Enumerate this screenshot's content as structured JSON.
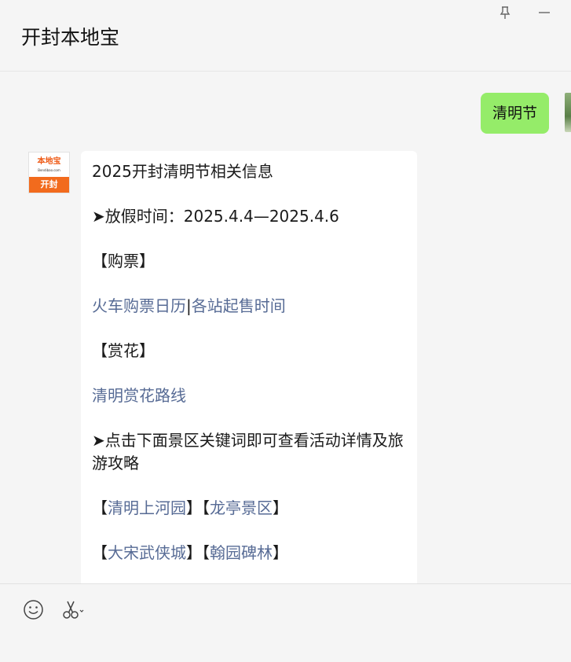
{
  "window": {
    "title": "开封本地宝",
    "pin_icon": "pin-icon",
    "minimize_icon": "minimize-icon"
  },
  "messages": {
    "outgoing": {
      "text": "清明节"
    },
    "incoming": {
      "avatar": {
        "brand": "本地宝",
        "url": "Bendibao.com",
        "city": "开封"
      },
      "heading": "2025开封清明节相关信息",
      "holiday": "➤放假时间：2025.4.4—2025.4.6",
      "ticket_section": "【购票】",
      "ticket_link_1": "火车购票日历",
      "ticket_separator": "|",
      "ticket_link_2": "各站起售时间",
      "flower_section": "【赏花】",
      "flower_link": "清明赏花路线",
      "scenic_intro": "➤点击下面景区关键词即可查看活动详情及旅游攻略",
      "scenic_row_1": [
        {
          "open": "【",
          "name": "清明上河园",
          "close": "】"
        },
        {
          "open": "【",
          "name": "龙亭景区",
          "close": "】"
        }
      ],
      "scenic_row_2": [
        {
          "open": "【",
          "name": "大宋武侠城",
          "close": "】"
        },
        {
          "open": "【",
          "name": "翰园碑林",
          "close": "】"
        }
      ]
    }
  },
  "toolbar": {
    "emoji_icon": "emoji-icon",
    "screenshot_icon": "scissors-icon"
  }
}
